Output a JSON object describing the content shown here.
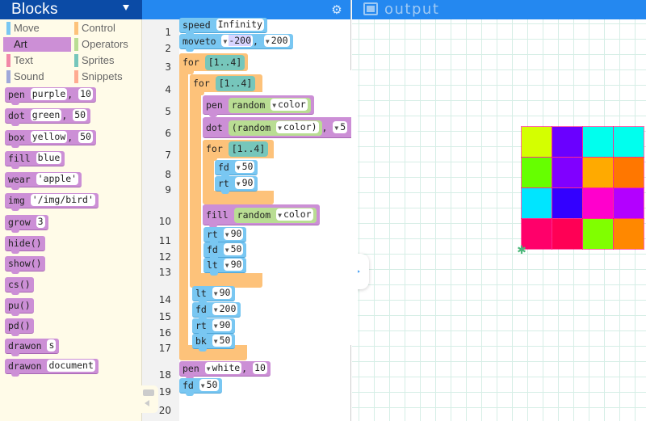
{
  "palette": {
    "title": "Blocks",
    "categories": [
      {
        "label": "Move",
        "color": "#79c7f2",
        "active": false
      },
      {
        "label": "Control",
        "color": "#fdc27a",
        "active": false
      },
      {
        "label": "Art",
        "color": "#cc8fd6",
        "active": true
      },
      {
        "label": "Operators",
        "color": "#b9dd93",
        "active": false
      },
      {
        "label": "Text",
        "color": "#f288a8",
        "active": false
      },
      {
        "label": "Sprites",
        "color": "#76c6bb",
        "active": false
      },
      {
        "label": "Sound",
        "color": "#9fa8da",
        "active": false
      },
      {
        "label": "Snippets",
        "color": "#ffab91",
        "active": false
      }
    ],
    "blocks": [
      {
        "cmd": "pen",
        "args": [
          "purple",
          "10"
        ]
      },
      {
        "cmd": "dot",
        "args": [
          "green",
          "50"
        ]
      },
      {
        "cmd": "box",
        "args": [
          "yellow",
          "50"
        ]
      },
      {
        "cmd": "fill",
        "args": [
          "blue"
        ]
      },
      {
        "cmd": "wear",
        "args": [
          "'apple'"
        ]
      },
      {
        "cmd": "img",
        "args": [
          "'/img/bird'"
        ]
      },
      {
        "cmd": "grow",
        "args": [
          "3"
        ]
      },
      {
        "cmd": "hide()",
        "args": []
      },
      {
        "cmd": "show()",
        "args": []
      },
      {
        "cmd": "cs()",
        "args": []
      },
      {
        "cmd": "pu()",
        "args": []
      },
      {
        "cmd": "pd()",
        "args": []
      },
      {
        "cmd": "drawon",
        "args": [
          "s"
        ]
      },
      {
        "cmd": "drawon",
        "args": [
          "document"
        ]
      }
    ]
  },
  "editor": {
    "line_numbers": [
      "1",
      "2",
      "3",
      "4",
      "5",
      "6",
      "7",
      "8",
      "9",
      "10",
      "11",
      "12",
      "13",
      "14",
      "15",
      "16",
      "17",
      "18",
      "19",
      "20"
    ],
    "code": {
      "l1": {
        "cmd": "speed",
        "arg": "Infinity"
      },
      "l2": {
        "cmd": "moveto",
        "arg1": "-200",
        "sep": ",",
        "arg2": "200"
      },
      "l3": {
        "cmd": "for",
        "range": "[1..4]"
      },
      "l4": {
        "cmd": "for",
        "range": "[1..4]"
      },
      "l5": {
        "cmd": "pen",
        "fn": "random",
        "arg": "color"
      },
      "l6": {
        "cmd": "dot",
        "fn": "(random",
        "arg": "color)",
        "sep": ",",
        "arg2": "5"
      },
      "l7": {
        "cmd": "for",
        "range": "[1..4]"
      },
      "l8": {
        "cmd": "fd",
        "arg": "50"
      },
      "l9": {
        "cmd": "rt",
        "arg": "90"
      },
      "l10": {
        "cmd": "fill",
        "fn": "random",
        "arg": "color"
      },
      "l11": {
        "cmd": "rt",
        "arg": "90"
      },
      "l12": {
        "cmd": "fd",
        "arg": "50"
      },
      "l13": {
        "cmd": "lt",
        "arg": "90"
      },
      "l14": {
        "cmd": "lt",
        "arg": "90"
      },
      "l15": {
        "cmd": "fd",
        "arg": "200"
      },
      "l16": {
        "cmd": "rt",
        "arg": "90"
      },
      "l17": {
        "cmd": "bk",
        "arg": "50"
      },
      "l18": {
        "cmd": "pen",
        "arg": "white",
        "sep": ",",
        "arg2": "10"
      },
      "l19": {
        "cmd": "fd",
        "arg": "50"
      }
    },
    "settings_icon": "gear-icon"
  },
  "output": {
    "title": "output",
    "icon": "output-screen-icon",
    "grid_cells": [
      [
        "#d4ff00",
        "#6a00ff",
        "#00ffee",
        "#00ffee"
      ],
      [
        "#66ff00",
        "#8000ff",
        "#ffaa00",
        "#ff7700"
      ],
      [
        "#00e5ff",
        "#3300ff",
        "#ff00cc",
        "#b300ff"
      ],
      [
        "#ff006a",
        "#ff0055",
        "#80ff00",
        "#ff8800"
      ]
    ]
  },
  "controls": {
    "run_button": "play-icon",
    "toggle": "comment-toggle-icon"
  }
}
